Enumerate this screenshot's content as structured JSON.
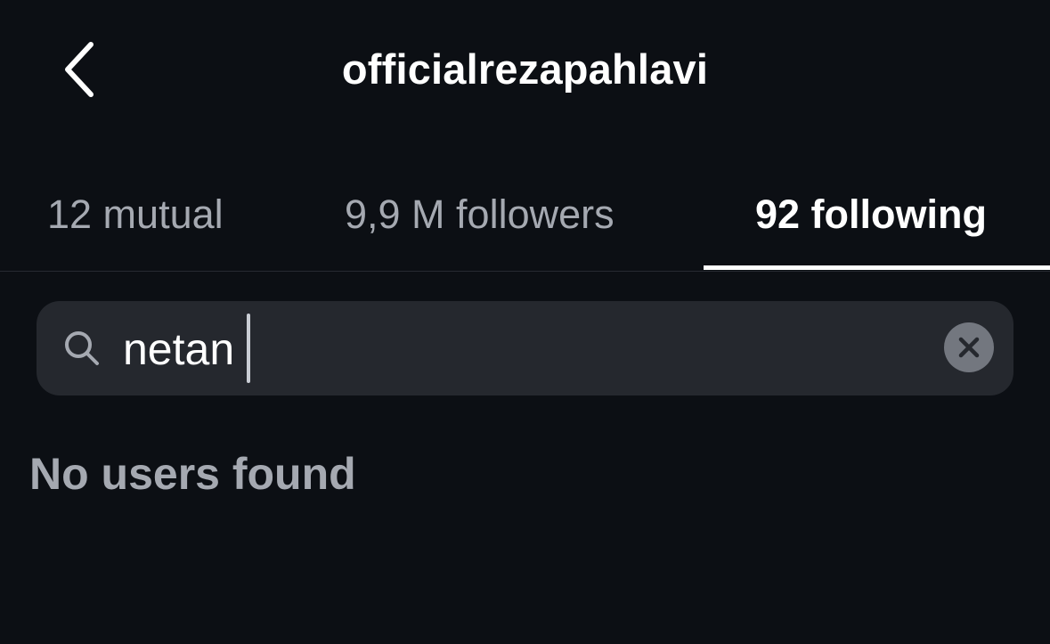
{
  "header": {
    "title": "officialrezapahlavi",
    "back_icon": "chevron-left-icon"
  },
  "tabs": [
    {
      "label": "12 mutual",
      "active": false
    },
    {
      "label": "9,9 M followers",
      "active": false
    },
    {
      "label": "92 following",
      "active": true
    }
  ],
  "search": {
    "value": "netan",
    "search_icon": "search-icon",
    "clear_icon": "close-icon"
  },
  "results": {
    "empty_message": "No users found"
  },
  "colors": {
    "background": "#0c0f14",
    "search_field": "#25282e",
    "muted_text": "#a5a9b1",
    "active_text": "#ffffff"
  }
}
